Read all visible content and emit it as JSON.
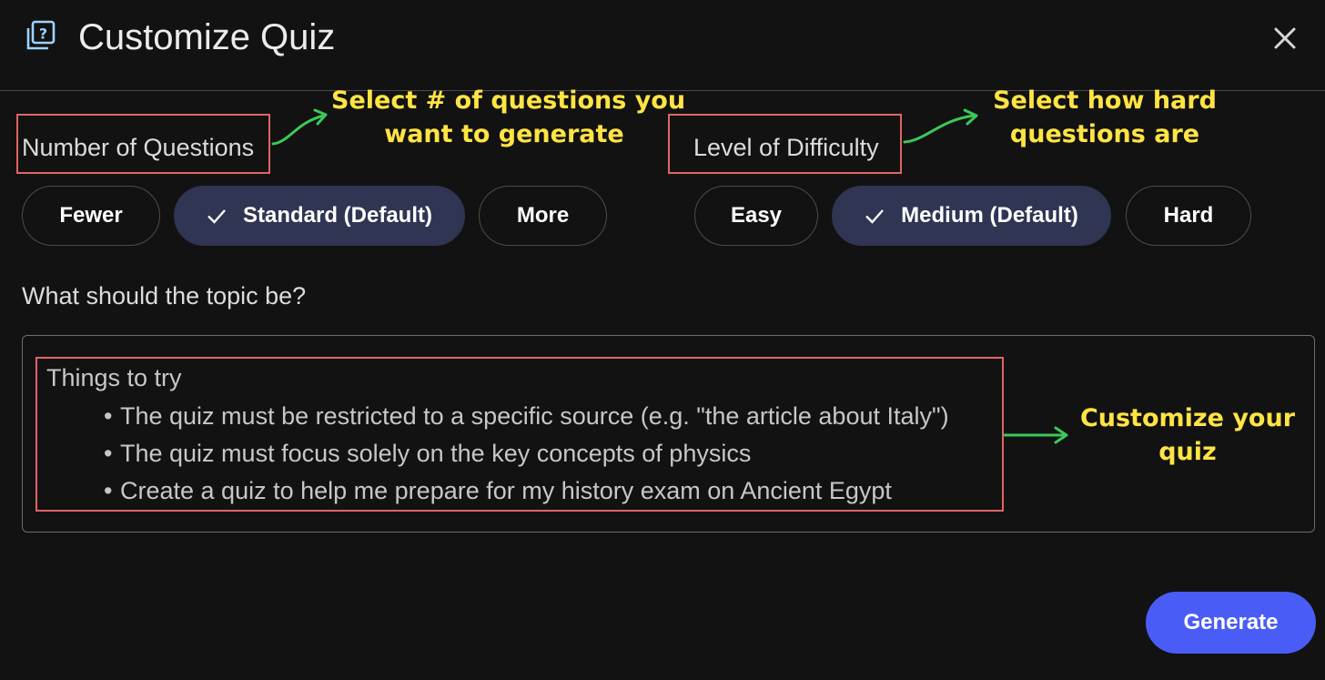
{
  "dialog": {
    "title": "Customize Quiz",
    "title_icon": "quiz-icon",
    "close_icon": "close-icon"
  },
  "questions": {
    "label": "Number of Questions",
    "options": [
      {
        "label": "Fewer",
        "selected": false
      },
      {
        "label": "Standard (Default)",
        "selected": true
      },
      {
        "label": "More",
        "selected": false
      }
    ]
  },
  "difficulty": {
    "label": "Level of Difficulty",
    "options": [
      {
        "label": "Easy",
        "selected": false
      },
      {
        "label": "Medium (Default)",
        "selected": true
      },
      {
        "label": "Hard",
        "selected": false
      }
    ]
  },
  "topic": {
    "label": "What should the topic be?",
    "placeholder_title": "Things to try",
    "suggestions": [
      "The quiz must be restricted to a specific source (e.g. \"the article about Italy\")",
      "The quiz must focus solely on the key concepts of physics",
      "Create a quiz to help me prepare for my history exam on Ancient Egypt"
    ]
  },
  "actions": {
    "generate_label": "Generate"
  },
  "annotations": {
    "questions_note": [
      "Select # of questions you",
      "want to generate"
    ],
    "difficulty_note": [
      "Select how hard",
      "questions are"
    ],
    "topic_note": [
      "Customize your",
      "quiz"
    ]
  },
  "colors": {
    "background": "#121212",
    "selected_pill": "#2f3552",
    "accent_button": "#4a5cf6",
    "annotation_text": "#ffe443",
    "annotation_box": "#e06468",
    "annotation_arrow": "#3cc85a"
  }
}
